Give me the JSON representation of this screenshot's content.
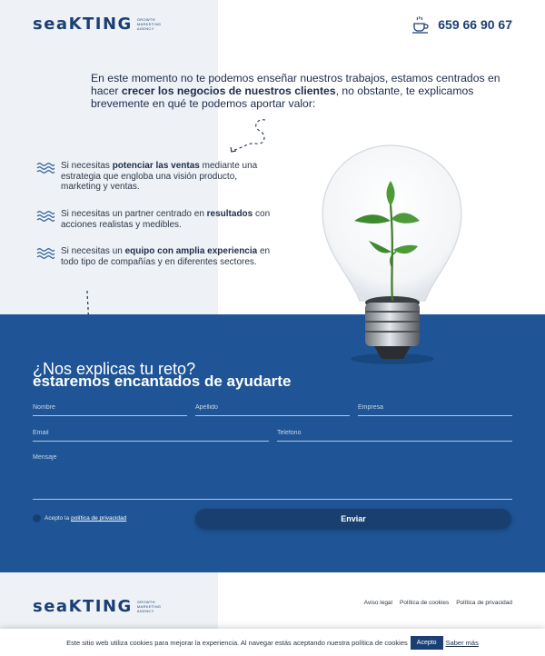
{
  "header": {
    "logo_word": "seaKTING",
    "logo_sub_1": "GROWTH",
    "logo_sub_2": "MARKETING",
    "logo_sub_3": "AGENCY",
    "phone": "659 66 90 67",
    "phone_icon": "coffee-cup-icon"
  },
  "intro": {
    "part1": "En este momento no te podemos enseñar nuestros trabajos, estamos centrados en hacer ",
    "bold": "crecer los negocios de nuestros clientes",
    "part2": ", no obstante, te explicamos brevemente en qué te podemos aportar valor:"
  },
  "benefits": [
    {
      "pre": "Si necesitas ",
      "bold": "potenciar las ventas",
      "post": " mediante una estrategia que engloba una visión producto, marketing y ventas."
    },
    {
      "pre": "Si necesitas un partner centrado en ",
      "bold": "resultados",
      "post": " con acciones realistas y medibles."
    },
    {
      "pre": "Si necesitas un ",
      "bold": "equipo con amplia experiencia",
      "post": " en todo tipo de compañías y en diferentes sectores."
    }
  ],
  "form": {
    "heading_1": "¿Nos explicas tu reto?",
    "heading_2": "estaremos encantados de ayudarte",
    "nombre": "Nombre",
    "apellido": "Apellido",
    "empresa": "Empresa",
    "email": "Email",
    "telefono": "Telefono",
    "mensaje": "Mensaje",
    "privacy_text": "Acepto la",
    "privacy_link": "política de privacidad",
    "submit": "Enviar"
  },
  "footer": {
    "links": [
      "Aviso legal",
      "Política de cookies",
      "Política de privacidad"
    ]
  },
  "cookie": {
    "text": "Este sitio web utiliza cookies para mejorar la experiencia. Al navegar estás aceptando nuestra política de cookies",
    "accept": "Acepto",
    "more": "Saber más"
  },
  "colors": {
    "brand": "#1b3f74",
    "form_bg": "#1f5596",
    "light_bg": "#eef2f6"
  }
}
